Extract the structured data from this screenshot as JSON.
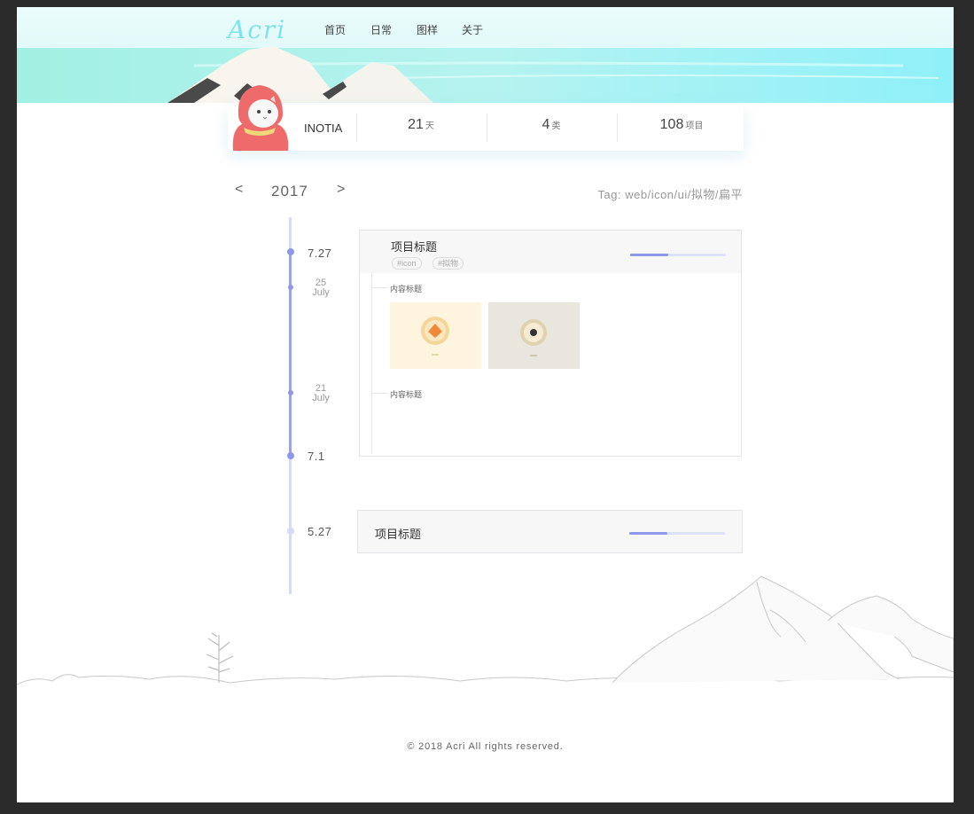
{
  "header": {
    "logo": "Acri",
    "nav": [
      "首页",
      "日常",
      "图样",
      "关于"
    ]
  },
  "profile": {
    "name": "INOTIA",
    "stats": [
      {
        "num": "21",
        "unit": "天"
      },
      {
        "num": "4",
        "unit": "类"
      },
      {
        "num": "108",
        "unit": "项目"
      }
    ]
  },
  "year_nav": {
    "prev": "<",
    "year": "2017",
    "next": ">",
    "tag": "Tag: web/icon/ui/拟物/扁平"
  },
  "timeline": {
    "dates": {
      "d1": "7.27",
      "d2_day": "25",
      "d2_month": "July",
      "d3_day": "21",
      "d3_month": "July",
      "d4": "7.1",
      "d5": "5.27"
    }
  },
  "cards": [
    {
      "title": "项目标题",
      "tags": [
        "#icon",
        "#拟物"
      ],
      "progress": 0.4,
      "sections": [
        "内容标题",
        "内容标题"
      ]
    },
    {
      "title": "项目标题",
      "progress": 0.4
    }
  ],
  "colors": {
    "accent": "#8f98e6",
    "timeline_light": "#d6d9f7",
    "logo": "#7de3ec"
  },
  "footer": "© 2018 Acri All rights reserved."
}
